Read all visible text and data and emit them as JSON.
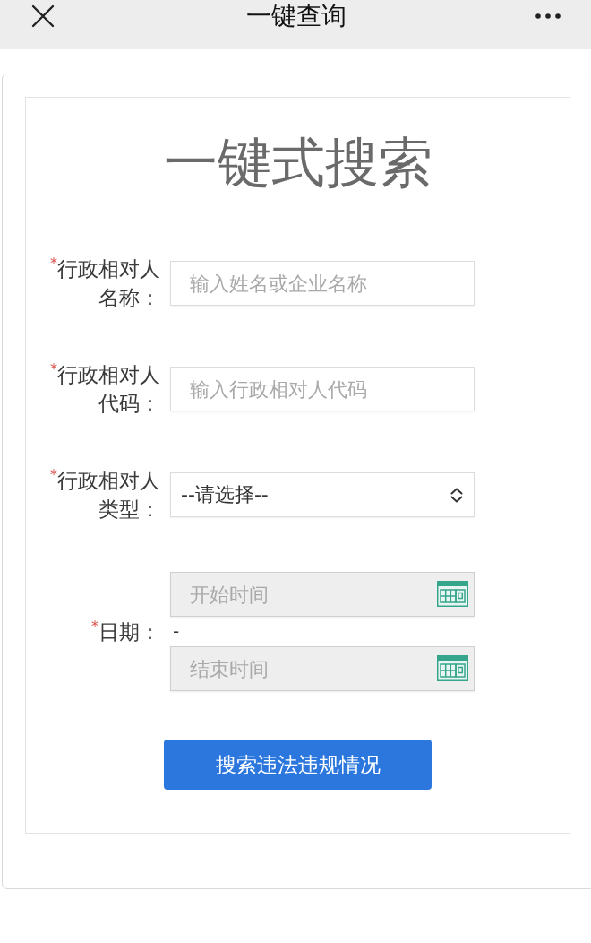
{
  "top_bar": {
    "title": "一键查询"
  },
  "form": {
    "title": "一键式搜索",
    "fields": [
      {
        "kind": "text",
        "mark": "*",
        "label": "行政相对人名称：",
        "placeholder": "输入姓名或企业名称"
      },
      {
        "kind": "text",
        "mark": "*",
        "label": "行政相对人代码：",
        "placeholder": "输入行政相对人代码"
      },
      {
        "kind": "select",
        "mark": "*",
        "label": "行政相对人类型：",
        "value": "--请选择--"
      },
      {
        "kind": "date_range",
        "mark": "*",
        "label": "日期：",
        "start": {
          "placeholder": "开始时间",
          "readonly": true
        },
        "separator": "-",
        "end": {
          "placeholder": "结束时间",
          "readonly": true
        }
      }
    ],
    "submit_button": "搜索违法违规情况"
  }
}
